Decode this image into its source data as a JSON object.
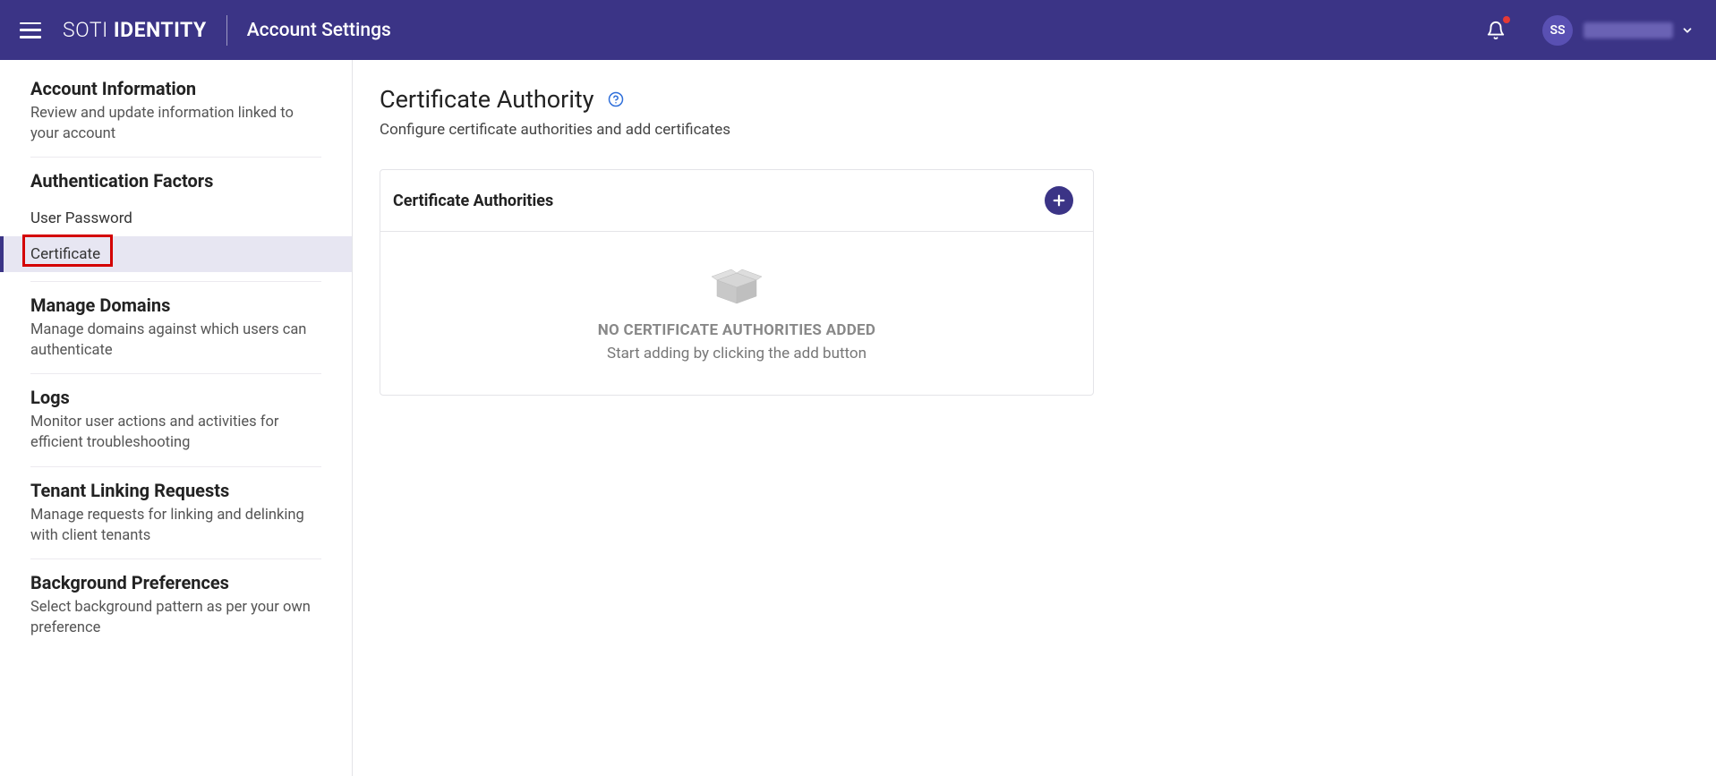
{
  "header": {
    "logo_prefix": "SOTI ",
    "logo_bold": "IDENTITY",
    "title": "Account Settings",
    "avatar_initials": "SS"
  },
  "sidebar": {
    "account_info": {
      "title": "Account Information",
      "desc": "Review and update information linked to your account"
    },
    "auth_factors": {
      "title": "Authentication Factors",
      "user_password": "User Password",
      "certificate": "Certificate"
    },
    "manage_domains": {
      "title": "Manage Domains",
      "desc": "Manage domains against which users can authenticate"
    },
    "logs": {
      "title": "Logs",
      "desc": "Monitor user actions and activities for efficient troubleshooting"
    },
    "tenant_linking": {
      "title": "Tenant Linking Requests",
      "desc": "Manage requests for linking and delinking with client tenants"
    },
    "background_prefs": {
      "title": "Background Preferences",
      "desc": "Select background pattern as per your own preference"
    }
  },
  "main": {
    "page_title": "Certificate Authority",
    "page_subtitle": "Configure certificate authorities and add certificates",
    "card_title": "Certificate Authorities",
    "empty_title": "NO CERTIFICATE AUTHORITIES ADDED",
    "empty_sub": "Start adding by clicking the add button"
  },
  "colors": {
    "brand": "#3b3486",
    "highlight": "#d40000"
  }
}
